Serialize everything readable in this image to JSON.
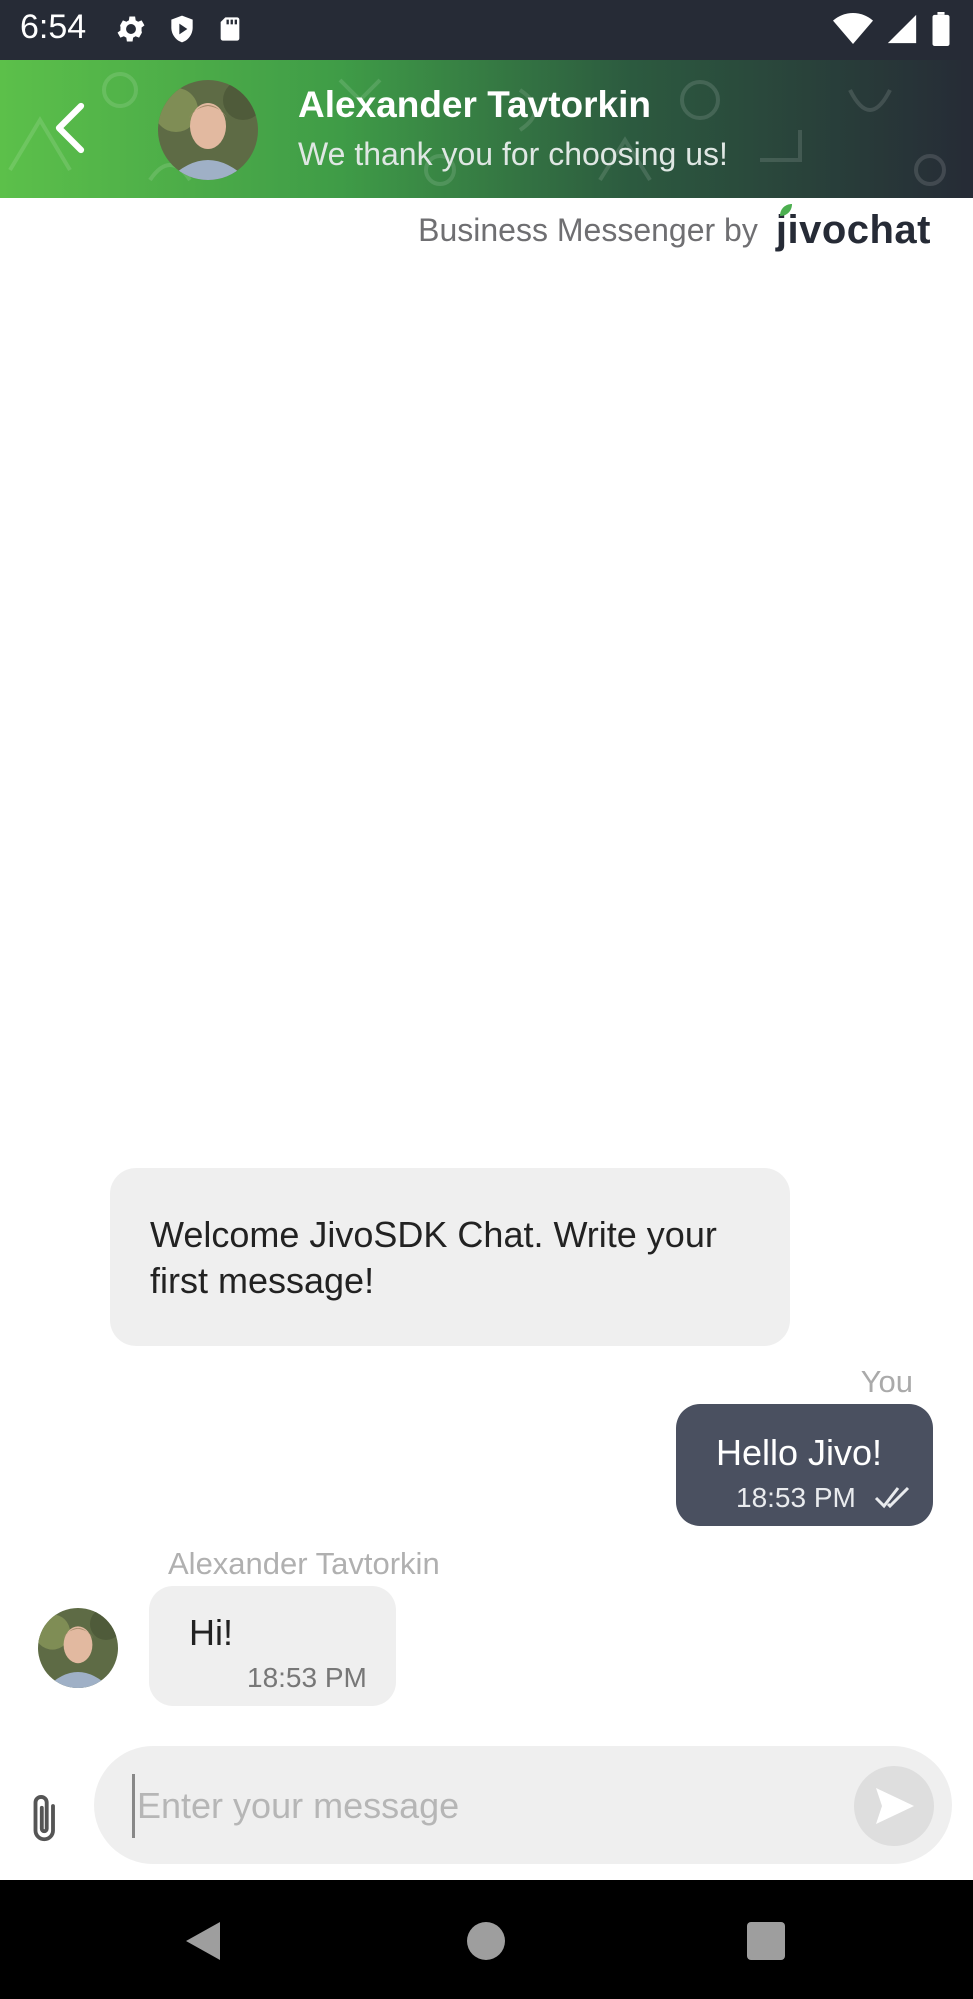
{
  "status_bar": {
    "time": "6:54",
    "left_icons": [
      "gear-icon",
      "shield-icon",
      "sd-card-icon"
    ],
    "right_icons": [
      "wifi-icon",
      "signal-icon",
      "battery-icon"
    ]
  },
  "header": {
    "agent_name": "Alexander Tavtorkin",
    "subtitle": "We thank you for choosing us!",
    "gradient_colors": [
      "#5cc04a",
      "#262b36"
    ]
  },
  "branding": {
    "text": "Business Messenger by",
    "logo": "jivochat",
    "logo_leaf_color": "#4caf50"
  },
  "messages": [
    {
      "direction": "incoming",
      "text": "Welcome JivoSDK Chat. Write your first message!"
    },
    {
      "direction": "outgoing",
      "sender": "You",
      "text": "Hello Jivo!",
      "time": "18:53 PM",
      "status": "read"
    },
    {
      "direction": "incoming",
      "sender": "Alexander Tavtorkin",
      "text": "Hi!",
      "time": "18:53 PM"
    }
  ],
  "composer": {
    "placeholder": "Enter your message",
    "value": ""
  },
  "colors": {
    "outgoing_bubble": "#4a5060",
    "incoming_bubble": "#efefef",
    "accent_green": "#5cc04a"
  }
}
